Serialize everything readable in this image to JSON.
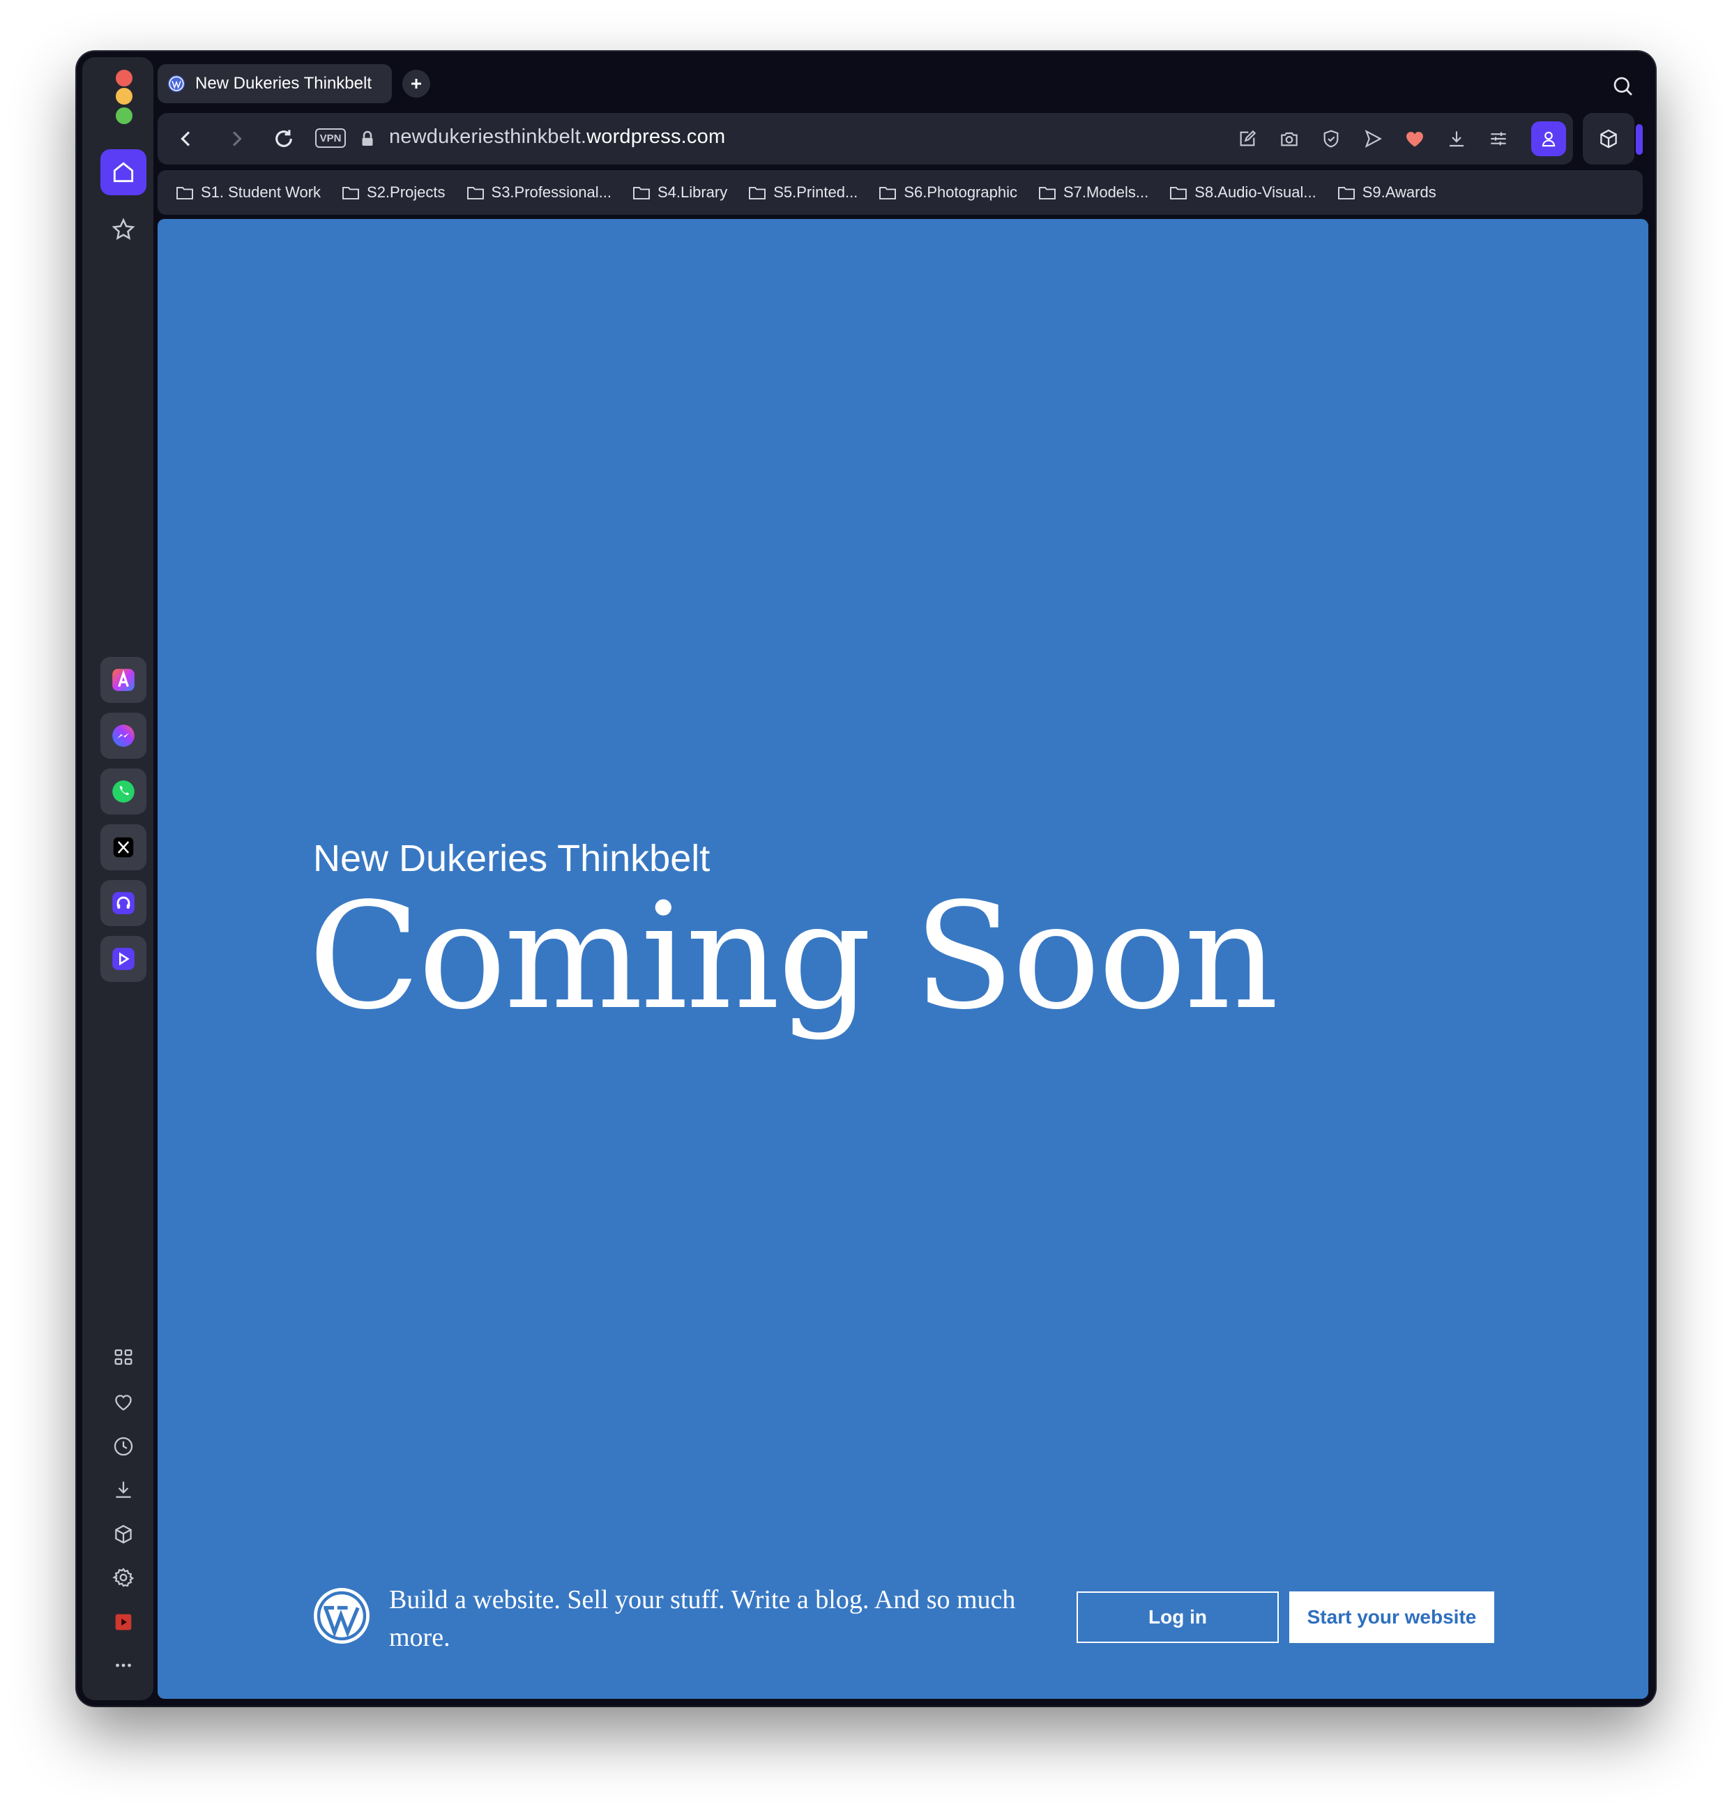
{
  "tab": {
    "title": "New Dukeries Thinkbelt"
  },
  "address_bar": {
    "vpn_label": "VPN",
    "url_prefix": "newdukeriesthinkbelt.",
    "url_domain": "wordpress.com"
  },
  "bookmarks": [
    "S1. Student Work",
    "S2.Projects",
    "S3.Professional...",
    "S4.Library",
    "S5.Printed...",
    "S6.Photographic",
    "S7.Models...",
    "S8.Audio-Visual...",
    "S9.Awards"
  ],
  "page": {
    "site_title": "New Dukeries Thinkbelt",
    "headline": "Coming Soon",
    "footer_text": "Build a website. Sell your stuff. Write a blog. And so much more.",
    "login_label": "Log in",
    "start_label": "Start your website"
  },
  "colors": {
    "page_background": "#3878c3",
    "accent": "#5b3df5",
    "window_background": "#0b0c17"
  },
  "icons": {
    "sidebar_top": [
      "home-icon",
      "star-icon"
    ],
    "sidebar_apps": [
      "aria-icon",
      "messenger-icon",
      "whatsapp-icon",
      "x-icon",
      "music-icon",
      "player-icon"
    ],
    "sidebar_bottom": [
      "grid-icon",
      "heart-icon",
      "history-icon",
      "download-icon",
      "cube-icon",
      "gear-icon",
      "video-icon",
      "more-icon"
    ],
    "toolbar": [
      "edit-icon",
      "camera-icon",
      "shield-icon",
      "send-icon",
      "heart-filled-icon",
      "download-icon",
      "settings-sliders-icon",
      "profile-icon"
    ]
  }
}
